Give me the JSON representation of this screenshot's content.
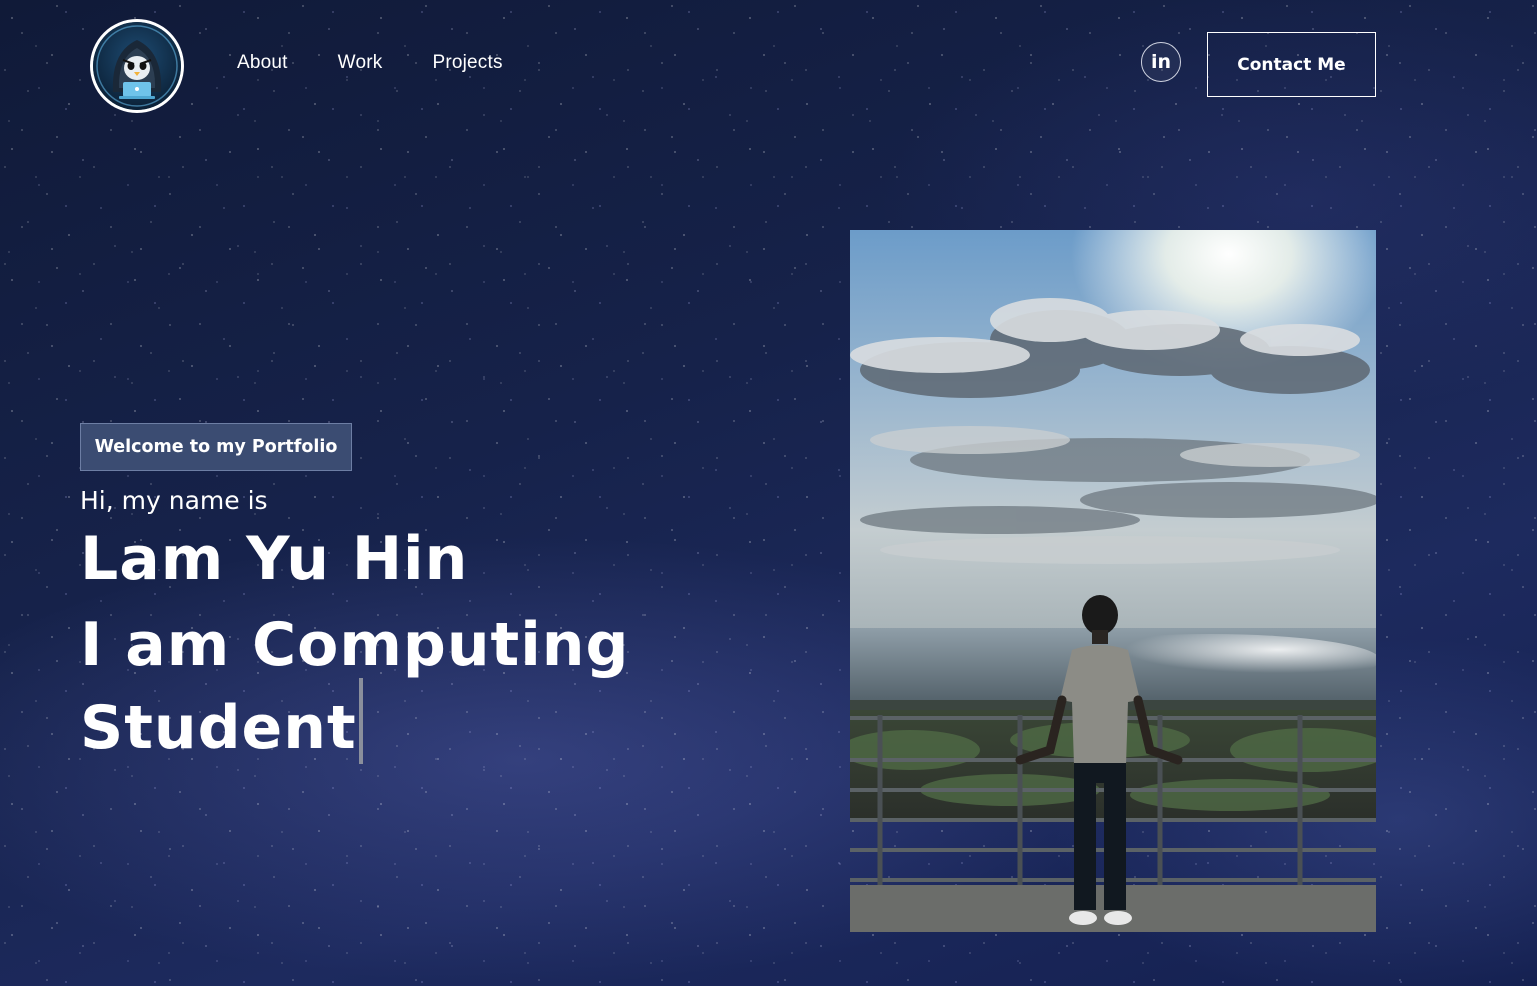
{
  "header": {
    "logo_icon": "hooded-penguin-hacker-icon",
    "nav": [
      {
        "label": "About"
      },
      {
        "label": "Work"
      },
      {
        "label": "Projects"
      }
    ],
    "social_icon": "linkedin-icon",
    "social_label": "in",
    "contact_label": "Contact Me"
  },
  "hero": {
    "badge": "Welcome to my Portfolio",
    "intro": "Hi, my name is",
    "name": "Lam Yu Hin",
    "role": "I am Computing Student"
  },
  "photo": {
    "subject": "person-standing-at-seaside-railing"
  },
  "colors": {
    "background": "#16224a",
    "badge_bg": "#3b4c72",
    "text": "#ffffff"
  }
}
